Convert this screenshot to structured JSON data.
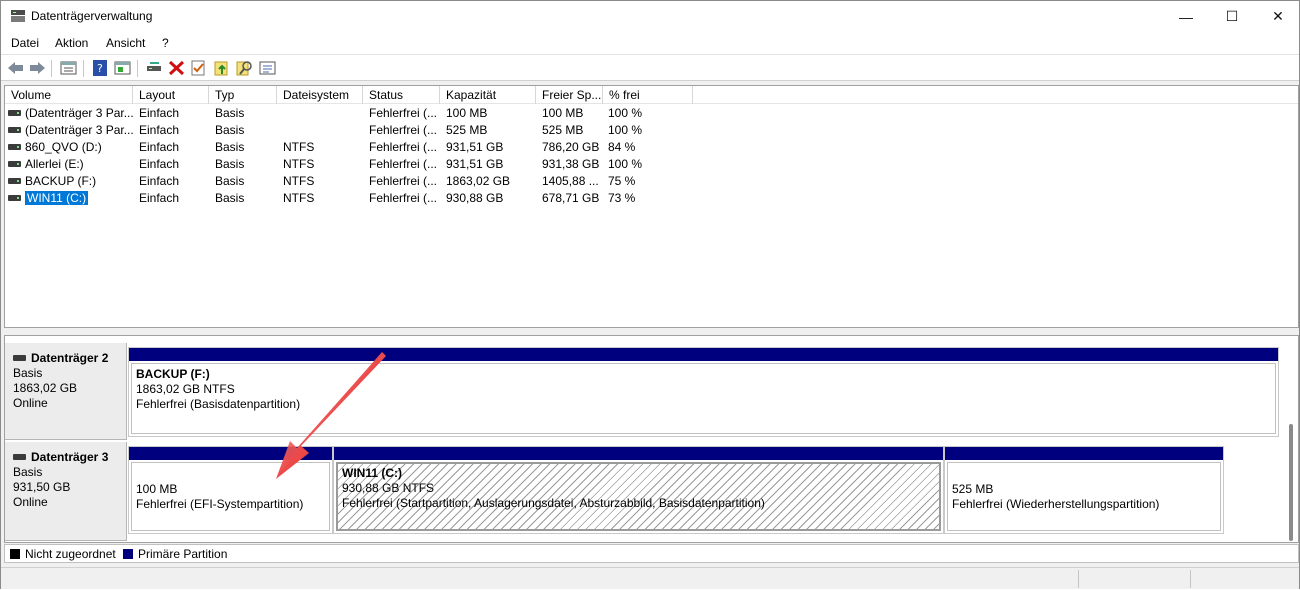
{
  "window": {
    "title": "Datenträgerverwaltung",
    "minimize": "—",
    "maximize": "☐",
    "close": "✕"
  },
  "menu": [
    "Datei",
    "Aktion",
    "Ansicht",
    "?"
  ],
  "toolbar_icons": [
    "back-icon",
    "forward-icon",
    "properties-list-icon",
    "help-icon",
    "show-hide-icon",
    "connect-icon",
    "delete-icon",
    "checklist-icon",
    "new-folder-icon",
    "search-icon",
    "console-icon"
  ],
  "columns": [
    "Volume",
    "Layout",
    "Typ",
    "Dateisystem",
    "Status",
    "Kapazität",
    "Freier Sp...",
    "% frei"
  ],
  "rows": [
    {
      "volume": "(Datenträger 3 Par...",
      "layout": "Einfach",
      "typ": "Basis",
      "fs": "",
      "status": "Fehlerfrei (...",
      "cap": "100 MB",
      "free": "100 MB",
      "pct": "100 %"
    },
    {
      "volume": "(Datenträger 3 Par...",
      "layout": "Einfach",
      "typ": "Basis",
      "fs": "",
      "status": "Fehlerfrei (...",
      "cap": "525 MB",
      "free": "525 MB",
      "pct": "100 %"
    },
    {
      "volume": "860_QVO (D:)",
      "layout": "Einfach",
      "typ": "Basis",
      "fs": "NTFS",
      "status": "Fehlerfrei (...",
      "cap": "931,51 GB",
      "free": "786,20 GB",
      "pct": "84 %"
    },
    {
      "volume": "Allerlei (E:)",
      "layout": "Einfach",
      "typ": "Basis",
      "fs": "NTFS",
      "status": "Fehlerfrei (...",
      "cap": "931,51 GB",
      "free": "931,38 GB",
      "pct": "100 %"
    },
    {
      "volume": "BACKUP (F:)",
      "layout": "Einfach",
      "typ": "Basis",
      "fs": "NTFS",
      "status": "Fehlerfrei (...",
      "cap": "1863,02 GB",
      "free": "1405,88 ...",
      "pct": "75 %"
    },
    {
      "volume": "WIN11 (C:)",
      "layout": "Einfach",
      "typ": "Basis",
      "fs": "NTFS",
      "status": "Fehlerfrei (...",
      "cap": "930,88 GB",
      "free": "678,71 GB",
      "pct": "73 %"
    }
  ],
  "disks": {
    "disk2": {
      "name": "Datenträger 2",
      "type": "Basis",
      "size": "1863,02 GB",
      "state": "Online",
      "partitions": {
        "backup": {
          "name": "BACKUP  (F:)",
          "size": "1863,02 GB NTFS",
          "status": "Fehlerfrei (Basisdatenpartition)"
        }
      }
    },
    "disk3": {
      "name": "Datenträger 3",
      "type": "Basis",
      "size": "931,50 GB",
      "state": "Online",
      "partitions": {
        "efi": {
          "size": "100 MB",
          "status": "Fehlerfrei (EFI-Systempartition)"
        },
        "win11": {
          "name": "WIN11  (C:)",
          "size": "930,88 GB NTFS",
          "status": "Fehlerfrei (Startpartition, Auslagerungsdatei, Absturzabbild, Basisdatenpartition)"
        },
        "recovery": {
          "size": "525 MB",
          "status": "Fehlerfrei (Wiederherstellungspartition)"
        }
      }
    }
  },
  "legend": {
    "unallocated": "Nicht zugeordnet",
    "primary": "Primäre Partition"
  },
  "colors": {
    "primary": "#00007f",
    "unallocated": "#000000",
    "selection": "#0078d7",
    "arrow": "#e8191e"
  }
}
